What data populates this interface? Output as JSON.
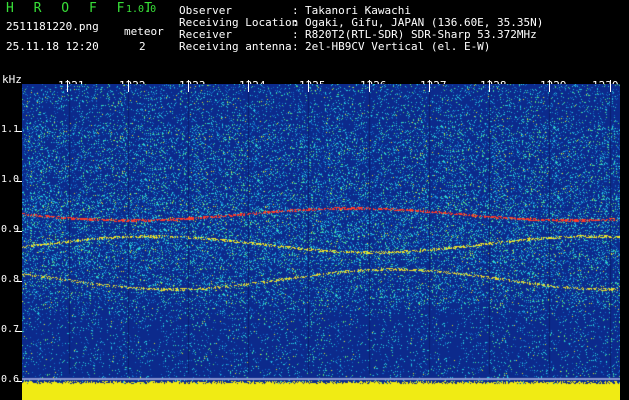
{
  "header": {
    "app_title": "H R O F F T",
    "app_version": "1.0.0",
    "file_name": "2511181220.png",
    "meteor_label": "meteor",
    "date_time": "25.11.18 12:20",
    "meteor_count": "2",
    "info_rows": [
      {
        "label": "Observer",
        "value": "Takanori Kawachi"
      },
      {
        "label": "Receiving Location",
        "value": "Ogaki, Gifu, JAPAN (136.60E, 35.35N)"
      },
      {
        "label": "Receiver",
        "value": "R820T2(RTL-SDR) SDR-Sharp 53.372MHz"
      },
      {
        "label": "Receiving antenna",
        "value": "2el-HB9CV Vertical (el. E-W)"
      }
    ],
    "separator": ":"
  },
  "spectrogram": {
    "y_unit": "kHz",
    "y_ticks": [
      "1.1",
      "1.0",
      "0.9",
      "0.8",
      "0.7",
      "0.6"
    ],
    "x_ticks": [
      "1221",
      "1222",
      "1223",
      "1224",
      "1225",
      "1226",
      "1227",
      "1228",
      "1229",
      "1230"
    ],
    "colors": {
      "background": "#0c2a8c",
      "noise_cyan": "#30d8e8",
      "signal_yellow": "#f0f000",
      "signal_red": "#ff3030",
      "baseline": "#e8e800"
    }
  }
}
